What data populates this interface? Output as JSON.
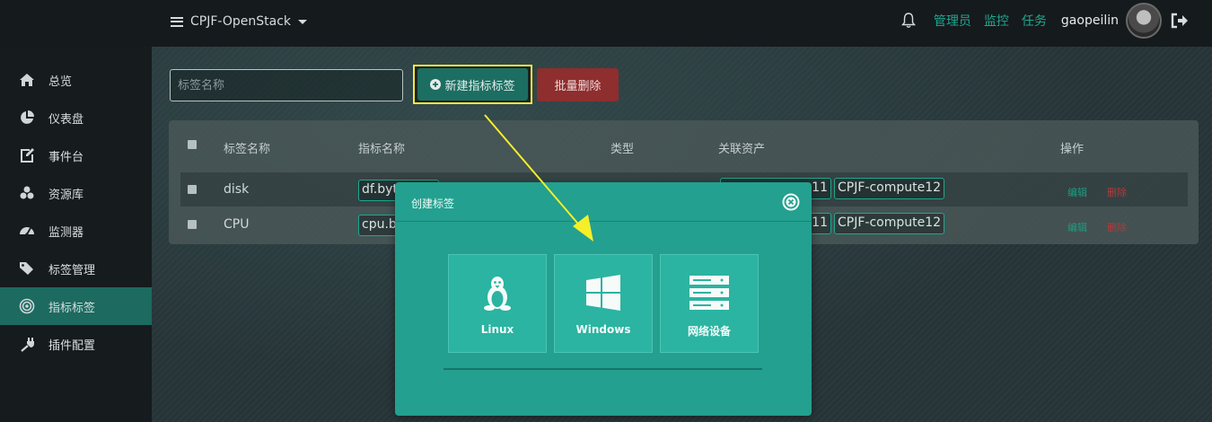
{
  "topbar": {
    "project": "CPJF-OpenStack",
    "links": [
      "管理员",
      "监控",
      "任务"
    ],
    "username": "gaopeilin"
  },
  "sidebar": {
    "items": [
      {
        "label": "总览",
        "icon": "home-icon"
      },
      {
        "label": "仪表盘",
        "icon": "pie-chart-icon"
      },
      {
        "label": "事件台",
        "icon": "edit-icon"
      },
      {
        "label": "资源库",
        "icon": "cubes-icon"
      },
      {
        "label": "监测器",
        "icon": "dashboard-icon"
      },
      {
        "label": "标签管理",
        "icon": "tags-icon"
      },
      {
        "label": "指标标签",
        "icon": "target-icon",
        "active": true
      },
      {
        "label": "插件配置",
        "icon": "plug-icon"
      }
    ]
  },
  "toolbar": {
    "search_placeholder": "标签名称",
    "new_label": "新建指标标签",
    "batch_delete_label": "批量删除"
  },
  "table": {
    "headers": [
      "标签名称",
      "指标名称",
      "类型",
      "关联资产",
      "操作"
    ],
    "rows": [
      {
        "name": "disk",
        "metric": "df.byt",
        "assets": [
          "11",
          "CPJF-compute12"
        ],
        "edit": "编辑",
        "delete": "删除"
      },
      {
        "name": "CPU",
        "metric": "cpu.bu",
        "assets": [
          "11",
          "CPJF-compute12"
        ],
        "edit": "编辑",
        "delete": "删除"
      }
    ]
  },
  "modal": {
    "title": "创建标签",
    "options": [
      "Linux",
      "Windows",
      "网络设备"
    ]
  },
  "colors": {
    "accent": "#1fa88f",
    "active_sidebar": "#1c6a60",
    "danger": "#8e2e2e",
    "highlight": "#f5e93a",
    "modal": "#23a08f"
  }
}
